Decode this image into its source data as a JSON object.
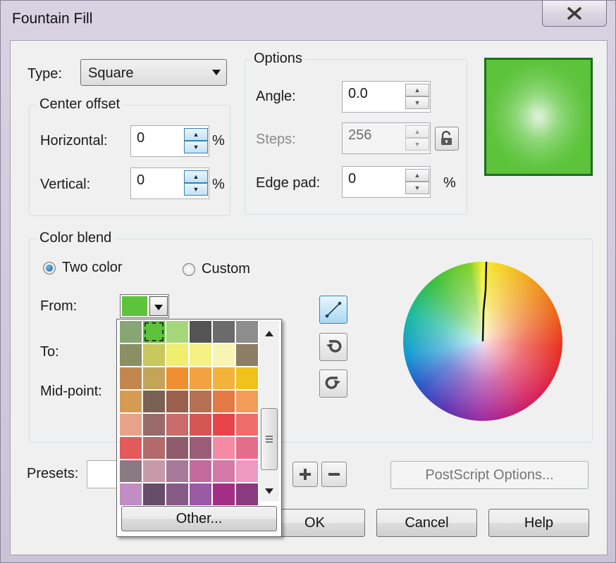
{
  "window": {
    "title": "Fountain Fill"
  },
  "type_field": {
    "label": "Type:",
    "value": "Square"
  },
  "center_offset": {
    "title": "Center offset",
    "horizontal_label": "Horizontal:",
    "horizontal_value": "0",
    "horizontal_unit": "%",
    "vertical_label": "Vertical:",
    "vertical_value": "0",
    "vertical_unit": "%"
  },
  "options": {
    "title": "Options",
    "angle_label": "Angle:",
    "angle_value": "0.0",
    "steps_label": "Steps:",
    "steps_value": "256",
    "edge_pad_label": "Edge pad:",
    "edge_pad_value": "0",
    "edge_pad_unit": "%"
  },
  "color_blend": {
    "title": "Color blend",
    "two_color_label": "Two color",
    "custom_label": "Custom",
    "selected_mode": "Two color",
    "from_label": "From:",
    "from_color": "#5cc33a",
    "to_label": "To:",
    "mid_point_label": "Mid-point:"
  },
  "palette": {
    "colors": [
      "#87a673",
      "#5cc33a",
      "#a6d67a",
      "#545454",
      "#6b6b6b",
      "#8d8d8d",
      "#8a8f64",
      "#c9c85c",
      "#f0ee6e",
      "#f5f183",
      "#f7f5b3",
      "#8c7d64",
      "#c2874f",
      "#c4a459",
      "#ef8f32",
      "#f3a141",
      "#f3b33b",
      "#f0c21a",
      "#d69b52",
      "#7a6154",
      "#9b5f4e",
      "#b56f52",
      "#e47946",
      "#f29c57",
      "#e8a28a",
      "#9a6a6a",
      "#c96c6a",
      "#d65656",
      "#e8454a",
      "#ee6d6a",
      "#e35a5a",
      "#b36a6a",
      "#8f5b6b",
      "#9b5d75",
      "#f48aa4",
      "#e46e8a",
      "#8a7a82",
      "#c69aa8",
      "#a67a98",
      "#c26a9c",
      "#d579a8",
      "#ec9ac0",
      "#c28cc4",
      "#664d68",
      "#885a88",
      "#9b5aa6",
      "#a42e86",
      "#8a3a7e"
    ],
    "selected_index": 1,
    "other_label": "Other..."
  },
  "presets": {
    "label": "Presets:",
    "value": ""
  },
  "buttons": {
    "postscript": "PostScript Options...",
    "ok": "OK",
    "cancel": "Cancel",
    "help": "Help"
  },
  "icons": {
    "close": "close-icon",
    "lock": "lock-icon",
    "line_blend": "line-blend-icon",
    "counterclockwise": "counterclockwise-icon",
    "clockwise": "clockwise-icon",
    "add": "plus-icon",
    "remove": "minus-icon"
  }
}
